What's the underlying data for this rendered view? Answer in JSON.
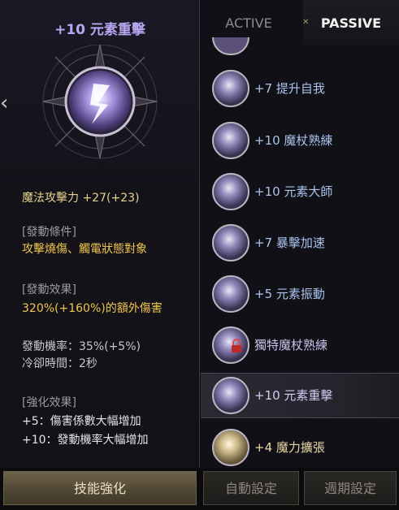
{
  "detail": {
    "title": "+10 元素重擊",
    "stat_label": "魔法攻擊力",
    "stat_value": "+27(+23)",
    "trigger_head": "[發動條件]",
    "trigger_text": "攻擊燒傷、觸電狀態對象",
    "effect_head": "[發動效果]",
    "effect_text": "320%(+160%)的額外傷害",
    "chance": "發動機率：35%(+5%)",
    "cooldown": "冷卻時間：2秒",
    "enhance_head": "[強化效果]",
    "enhance_1": "+5：傷害係數大幅增加",
    "enhance_2": "+10：發動機率大幅增加"
  },
  "tabs": {
    "active": "ACTIVE",
    "passive": "PASSIVE"
  },
  "skills": [
    {
      "label": "+7 提升自我"
    },
    {
      "label": "+10 魔杖熟練"
    },
    {
      "label": "+10 元素大師"
    },
    {
      "label": "+7 暴擊加速"
    },
    {
      "label": "+5 元素振動"
    },
    {
      "label": "獨特魔杖熟練"
    },
    {
      "label": "+10 元素重擊"
    },
    {
      "label": "+4 魔力擴張"
    }
  ],
  "buttons": {
    "enhance": "技能強化",
    "auto": "自動設定",
    "period": "週期設定"
  },
  "colors": {
    "accent_purple": "#b7a6f0",
    "stat_yellow": "#f0c64e",
    "skill_blue": "#a9c3ee",
    "button_gold": "#6f634c"
  }
}
